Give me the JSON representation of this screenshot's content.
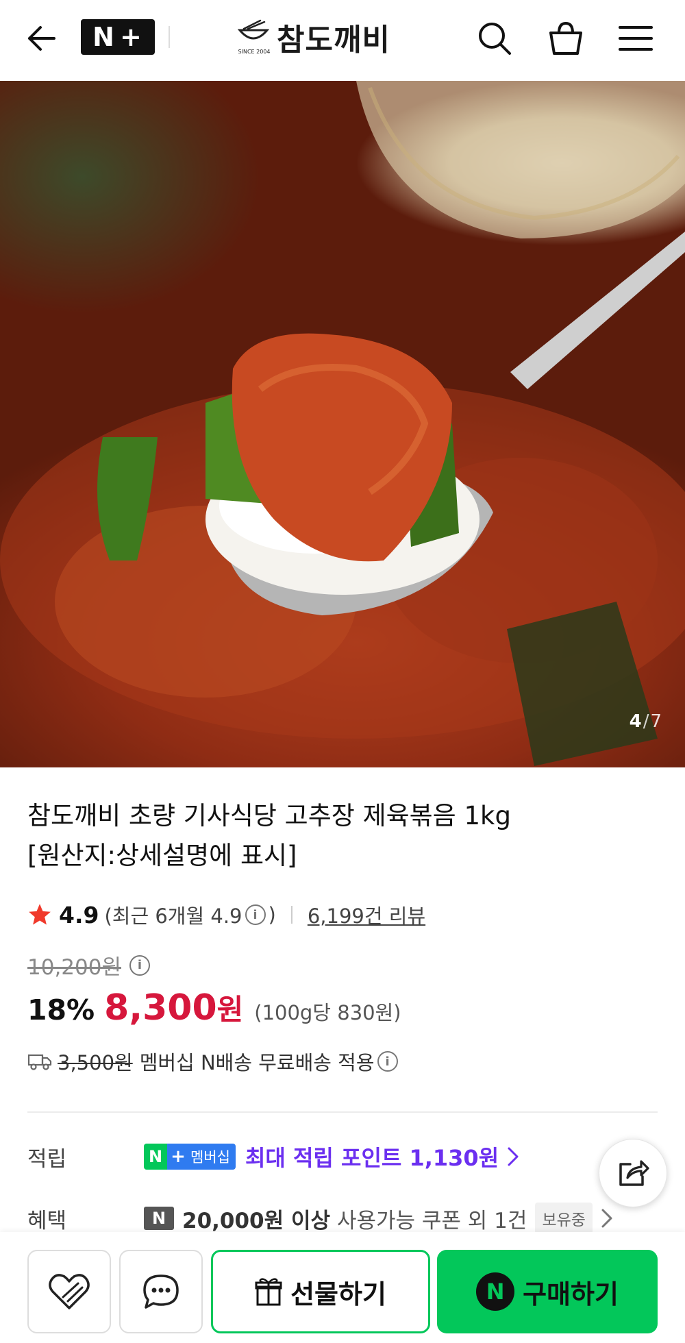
{
  "header": {
    "badge_n": "N",
    "badge_plus": "+",
    "brand_since": "SINCE 2004",
    "brand_name": "참도깨비"
  },
  "hero": {
    "counter_current": "4",
    "counter_sep": "/",
    "counter_total": "7"
  },
  "product": {
    "title_line1": "참도깨비 초량 기사식당 고추장 제육볶음 1kg",
    "title_line2": "[원산지:상세설명에 표시]",
    "rating": "4.9",
    "recent_open": "(최근 6개월 4.9",
    "recent_close": ")",
    "reviews": "6,199건 리뷰",
    "original_price": "10,200원",
    "discount": "18%",
    "sale_price": "8,300",
    "sale_unit": "원",
    "unit_price": "(100g당 830원)",
    "shipping_strike": "3,500원",
    "shipping_text": "멤버십 N배송 무료배송 적용"
  },
  "benefits": {
    "points_label": "적립",
    "np_n": "N",
    "np_plus": "+",
    "np_mem": "멤버십",
    "points_text": "최대 적립 포인트 1,130원",
    "coupon_label": "혜택",
    "coupon_icon": "N",
    "coupon_bold": "20,000원 이상",
    "coupon_rest": "사용가능 쿠폰 외 1건",
    "owned_tag": "보유중"
  },
  "bottom": {
    "gift_label": "선물하기",
    "buy_n": "N",
    "buy_label": "구매하기"
  },
  "colors": {
    "naver_green": "#03c75a",
    "sale_red": "#d6173c",
    "points_purple": "#6b2ff0",
    "membership_blue": "#2f7bf0"
  },
  "icons": [
    "back-arrow-icon",
    "search-icon",
    "shopping-bag-icon",
    "hamburger-menu-icon",
    "star-icon",
    "info-icon",
    "truck-icon",
    "chevron-right-icon",
    "share-icon",
    "heart-icon",
    "chat-icon",
    "gift-icon"
  ]
}
